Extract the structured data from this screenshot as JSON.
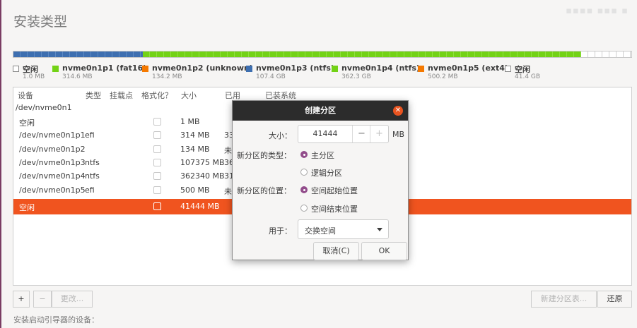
{
  "title": "安装类型",
  "partition_legend": [
    {
      "name": "空闲",
      "size": "1.0 MB",
      "color": "#ffffff"
    },
    {
      "name": "nvme0n1p1 (fat16)",
      "size": "314.6 MB",
      "color": "#73d216"
    },
    {
      "name": "nvme0n1p2 (unknown)",
      "size": "134.2 MB",
      "color": "#f57900"
    },
    {
      "name": "nvme0n1p3 (ntfs)",
      "size": "107.4 GB",
      "color": "#3e6fb0"
    },
    {
      "name": "nvme0n1p4 (ntfs)",
      "size": "362.3 GB",
      "color": "#73d216"
    },
    {
      "name": "nvme0n1p5 (ext4)",
      "size": "500.2 MB",
      "color": "#f57900"
    },
    {
      "name": "空闲",
      "size": "41.4 GB",
      "color": "#ffffff"
    }
  ],
  "table": {
    "headers": {
      "device": "设备",
      "type": "类型",
      "mount": "挂载点",
      "format": "格式化？",
      "size": "大小",
      "used": "已用",
      "system": "已装系统"
    },
    "disk": "/dev/nvme0n1",
    "rows": [
      {
        "device": "空闲",
        "type": "",
        "size": "1 MB",
        "used": "",
        "selected": false
      },
      {
        "device": "/dev/nvme0n1p1",
        "type": "efi",
        "size": "314 MB",
        "used": "33",
        "selected": false
      },
      {
        "device": "/dev/nvme0n1p2",
        "type": "",
        "size": "134 MB",
        "used": "未",
        "selected": false
      },
      {
        "device": "/dev/nvme0n1p3",
        "type": "ntfs",
        "size": "107375 MB",
        "used": "36",
        "selected": false
      },
      {
        "device": "/dev/nvme0n1p4",
        "type": "ntfs",
        "size": "362340 MB",
        "used": "31",
        "selected": false
      },
      {
        "device": "/dev/nvme0n1p5",
        "type": "efi",
        "size": "500 MB",
        "used": "未",
        "selected": false
      },
      {
        "device": "空闲",
        "type": "",
        "size": "41444 MB",
        "used": "",
        "selected": true
      }
    ]
  },
  "toolbar": {
    "add": "+",
    "remove": "−",
    "change": "更改...",
    "new_table": "新建分区表...",
    "revert": "还原"
  },
  "boot_label": "安装启动引导器的设备：",
  "dialog": {
    "title": "创建分区",
    "size_label": "大小：",
    "size_value": "41444",
    "size_minus": "−",
    "size_plus": "+",
    "size_unit": "MB",
    "type_label": "新分区的类型：",
    "type_primary": "主分区",
    "type_logical": "逻辑分区",
    "type_selected": "primary",
    "location_label": "新分区的位置：",
    "location_begin": "空间起始位置",
    "location_end": "空间结束位置",
    "location_selected": "begin",
    "use_label": "用于：",
    "use_value": "交换空间",
    "cancel": "取消(C)",
    "ok": "OK"
  }
}
